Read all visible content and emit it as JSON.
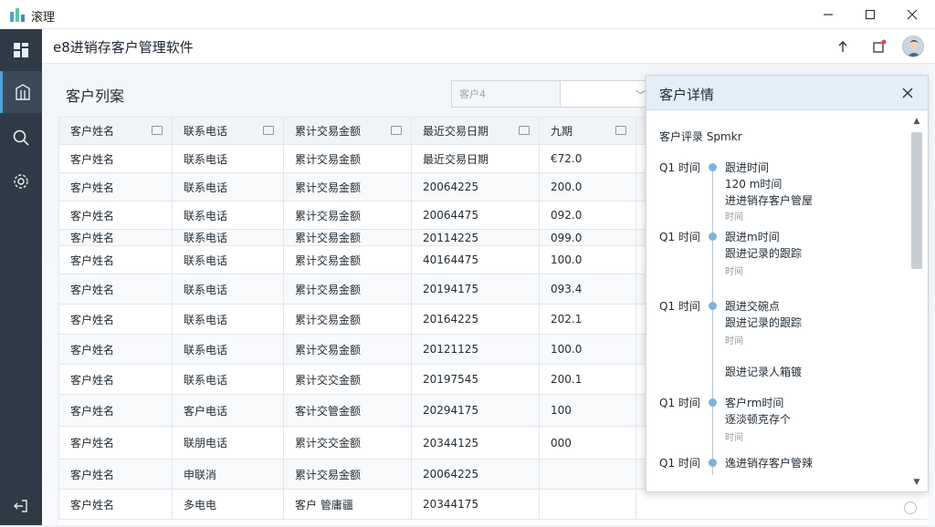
{
  "window": {
    "title": "滚理"
  },
  "app": {
    "title": "e8进销存客户管理软件"
  },
  "page": {
    "title": "客户列案"
  },
  "search": {
    "placeholder": "客户4"
  },
  "table": {
    "columns": [
      "客户姓名",
      "联系电话",
      "累计交易金额",
      "最近交易日期",
      "九期"
    ],
    "rows": [
      [
        "客户姓名",
        "联系电话",
        "累计交易金额",
        "最近交易日期",
        "€72.0"
      ],
      [
        "客户姓名",
        "联系电话",
        "累计交易金额",
        "20064225",
        "200.0"
      ],
      [
        "客户姓名",
        "联系电话",
        "累计交易金额",
        "20064475",
        "092.0"
      ],
      [
        "客户姓名",
        "联系电话",
        "累计交易金额",
        "20114225",
        "099.0"
      ],
      [
        "客户姓名",
        "联系电话",
        "累计交易金额",
        "40164475",
        "100.0"
      ],
      [
        "客户姓名",
        "联系电话",
        "累计交易金额",
        "20194175",
        "093.4"
      ],
      [
        "客户姓名",
        "联系电话",
        "累计交易金额",
        "20164225",
        "202.1"
      ],
      [
        "客户姓名",
        "联系电话",
        "累计交易金额",
        "20121125",
        "100.0"
      ],
      [
        "客户姓名",
        "联系电话",
        "累计交交金额",
        "20197545",
        "200.1"
      ],
      [
        "客户姓名",
        "客户电话",
        "客计交管金额",
        "20294175",
        "100"
      ],
      [
        "客户姓名",
        "联朋电话",
        "累计交交金额",
        "20344125",
        "000"
      ],
      [
        "客户姓名",
        "申联消",
        "累计交易金额",
        "20064225",
        ""
      ],
      [
        "客户姓名",
        "多电电",
        "客户 管庸疆",
        "20344175",
        ""
      ]
    ]
  },
  "detail": {
    "title": "客户详情",
    "subtitle": "客户评录 Spmkr",
    "entries": [
      {
        "time": "Q1 时间",
        "line1": "跟进时间",
        "line2": "120 m时间",
        "line3": "进进销存客户管屋",
        "small": "时间"
      },
      {
        "time": "Q1 时间",
        "line1": "跟进m时间",
        "line2": "跟进记录的跟踪",
        "small": "时间"
      },
      {
        "time": "Q1 时间",
        "line1": "跟进交碗点",
        "line2": "跟进记录的跟踪",
        "small": "时间"
      },
      {
        "time": "",
        "line1": "跟进记录人箱镀",
        "line2": "",
        "small": ""
      },
      {
        "time": "Q1 时间",
        "line1": "客户rm时间",
        "line2": "逐淡顿克存个",
        "small": "时间"
      },
      {
        "time": "Q1 时间",
        "line1": "逸进销存客户管辣",
        "line2": "",
        "small": ""
      }
    ]
  },
  "colors": {
    "rail": "#2e3b46",
    "accent": "#4ea3d8",
    "panel_header": "#e3eef7"
  },
  "icons": [
    "app-logo-icon",
    "minimize-icon",
    "maximize-icon",
    "close-icon",
    "dashboard-icon",
    "building-icon",
    "search-icon",
    "settings-icon",
    "logout-icon",
    "upload-icon",
    "notification-icon"
  ]
}
